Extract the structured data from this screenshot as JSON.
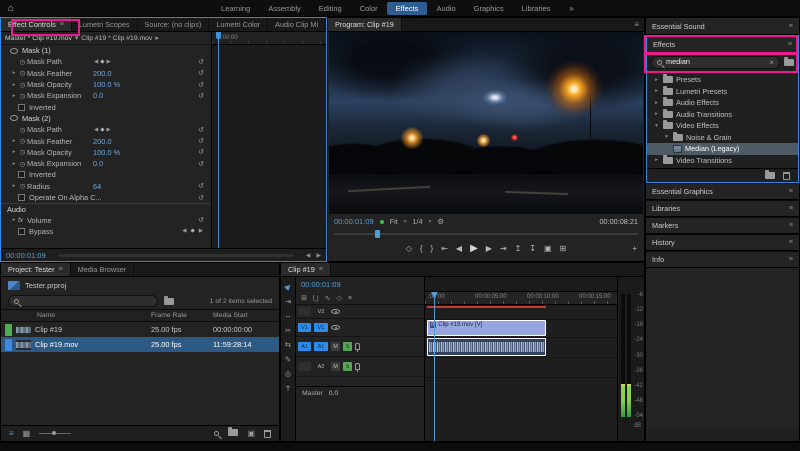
{
  "colors": {
    "accent_blue": "#2d8ceb",
    "timecode_blue": "#4f9fd6",
    "annotation_pink": "#ed1a8b",
    "selection_blue": "#2d5a85",
    "solo_green": "#58a558",
    "label_green": "#4fae50",
    "label_blue": "#3f8ae0",
    "clip_lavender": "#98a6e0",
    "render_red": "#c23b2e",
    "meter_green": "#2f9e3f"
  },
  "topbar": {
    "home_icon": "⌂",
    "tabs": [
      "Learning",
      "Assembly",
      "Editing",
      "Color",
      "Effects",
      "Audio",
      "Graphics",
      "Libraries"
    ],
    "active_tab": "Effects",
    "overflow_icon": "»"
  },
  "effect_controls": {
    "tabs": [
      "Effect Controls",
      "Lumetri Scopes",
      "Source: (no clips)",
      "Lumetri Color",
      "Audio Clip Mi"
    ],
    "active_tab": "Effect Controls",
    "master_clip": "Master * Clip #19.mov",
    "sub_clip": "Clip #19 * Clip #19.mov",
    "ruler_label": ";00:00",
    "timecode": "00:00:01:09",
    "rows": [
      {
        "type": "section",
        "label": "Mask (1)"
      },
      {
        "type": "keyframe",
        "label": "Mask Path"
      },
      {
        "type": "value",
        "label": "Mask Feather",
        "value": "200.0"
      },
      {
        "type": "value",
        "label": "Mask Opacity",
        "value": "100.0 %"
      },
      {
        "type": "value",
        "label": "Mask Expansion",
        "value": "0.0"
      },
      {
        "type": "checkbox",
        "label": "Inverted",
        "checked": false
      },
      {
        "type": "section",
        "label": "Mask (2)"
      },
      {
        "type": "keyframe",
        "label": "Mask Path"
      },
      {
        "type": "value",
        "label": "Mask Feather",
        "value": "200.0"
      },
      {
        "type": "value",
        "label": "Mask Opacity",
        "value": "100.0 %"
      },
      {
        "type": "value",
        "label": "Mask Expansion",
        "value": "0.0"
      },
      {
        "type": "checkbox",
        "label": "Inverted",
        "checked": false
      },
      {
        "type": "value",
        "label": "Radius",
        "value": "64"
      },
      {
        "type": "checkbox",
        "label": "Operate On Alpha C...",
        "checked": false
      },
      {
        "type": "section",
        "label": "Audio"
      },
      {
        "type": "fx",
        "label": "Volume"
      },
      {
        "type": "checkbox-kf",
        "label": "Bypass",
        "checked": false
      }
    ]
  },
  "program": {
    "title": "Program: Clip #19",
    "timecode": "00:00:01:09",
    "zoom": "Fit",
    "resolution": "1/4",
    "duration": "00:00:08:21",
    "transport": [
      {
        "name": "add-marker",
        "glyph": "◇"
      },
      {
        "name": "mark-in",
        "glyph": "{"
      },
      {
        "name": "mark-out",
        "glyph": "}"
      },
      {
        "name": "go-to-in",
        "glyph": "⇤"
      },
      {
        "name": "step-back",
        "glyph": "◀"
      },
      {
        "name": "play",
        "glyph": "▶"
      },
      {
        "name": "step-forward",
        "glyph": "▶"
      },
      {
        "name": "go-to-out",
        "glyph": "⇥"
      },
      {
        "name": "lift",
        "glyph": "↥"
      },
      {
        "name": "extract",
        "glyph": "↧"
      },
      {
        "name": "export-frame",
        "glyph": "▣"
      },
      {
        "name": "comparison-view",
        "glyph": "⊞"
      },
      {
        "name": "button-editor",
        "glyph": "+"
      }
    ]
  },
  "effects_panel": {
    "essential_sound_title": "Essential Sound",
    "title": "Effects",
    "search_value": "median",
    "tree": [
      {
        "label": "Presets",
        "indent": 0,
        "expanded": false
      },
      {
        "label": "Lumetri Presets",
        "indent": 0,
        "expanded": false
      },
      {
        "label": "Audio Effects",
        "indent": 0,
        "expanded": false
      },
      {
        "label": "Audio Transitions",
        "indent": 0,
        "expanded": false
      },
      {
        "label": "Video Effects",
        "indent": 0,
        "expanded": true
      },
      {
        "label": "Noise & Grain",
        "indent": 1,
        "expanded": true
      },
      {
        "label": "Median (Legacy)",
        "indent": 2,
        "selected": true
      },
      {
        "label": "Video Transitions",
        "indent": 0,
        "expanded": false
      }
    ],
    "collapsed_panels": [
      "Essential Graphics",
      "Libraries",
      "Markers",
      "History",
      "Info"
    ]
  },
  "project": {
    "tabs": [
      "Project: Tester",
      "Media Browser"
    ],
    "active_tab": "Project: Tester",
    "file_name": "Tester.prproj",
    "selection_status": "1 of 2 items selected",
    "columns": [
      "Name",
      "Frame Rate",
      "Media Start"
    ],
    "rows": [
      {
        "name": "Clip #19",
        "frame_rate": "25.00 fps",
        "media_start": "00:00:00:00",
        "selected": false
      },
      {
        "name": "Clip #19.mov",
        "frame_rate": "25.00 fps",
        "media_start": "11:59:28:14",
        "selected": true
      }
    ]
  },
  "timeline": {
    "tab": "Clip #19",
    "timecode": "00:00:01:09",
    "ruler_labels": [
      ":00:00",
      "00:00:05:00",
      "00:00:10:00",
      "00:00:15:00"
    ],
    "video_clip_label": "Clip #19.mov [V]",
    "tracks": {
      "v2": "V2",
      "v1": "V1",
      "a1": "A1",
      "a2": "A2",
      "master_label": "Master",
      "master_value": "0.0",
      "mute": "M",
      "solo": "S"
    },
    "tools": [
      {
        "name": "selection-tool",
        "glyph": "▶"
      },
      {
        "name": "track-select-tool",
        "glyph": "⇥"
      },
      {
        "name": "ripple-edit-tool",
        "glyph": "↔"
      },
      {
        "name": "razor-tool",
        "glyph": "✂"
      },
      {
        "name": "slip-tool",
        "glyph": "⇆"
      },
      {
        "name": "pen-tool",
        "glyph": "✎"
      },
      {
        "name": "hand-tool",
        "glyph": "◎"
      },
      {
        "name": "type-tool",
        "glyph": "T"
      }
    ],
    "minibar": [
      {
        "name": "nest-toggle",
        "glyph": "⊞"
      },
      {
        "name": "snap-toggle",
        "glyph": "⋃"
      },
      {
        "name": "linked-selection",
        "glyph": "∿"
      },
      {
        "name": "add-marker",
        "glyph": "◇"
      },
      {
        "name": "timeline-settings",
        "glyph": "≡"
      }
    ]
  },
  "audio_meter": {
    "scale": [
      "-6",
      "-12",
      "-18",
      "-24",
      "-30",
      "-36",
      "-42",
      "-48",
      "-54"
    ],
    "unit": "dB"
  },
  "icons": {
    "menu": "≡",
    "chevron_down": "▾",
    "twirl_closed": "▸",
    "twirl_open": "▾",
    "stopwatch": "◷",
    "reset": "↺",
    "kf_prev": "◀",
    "kf_add": "◆",
    "kf_next": "▶",
    "clear": "×",
    "settings": "⚙",
    "fx": "fx",
    "list": "≡",
    "grid": "▦",
    "new_item": "▣"
  }
}
